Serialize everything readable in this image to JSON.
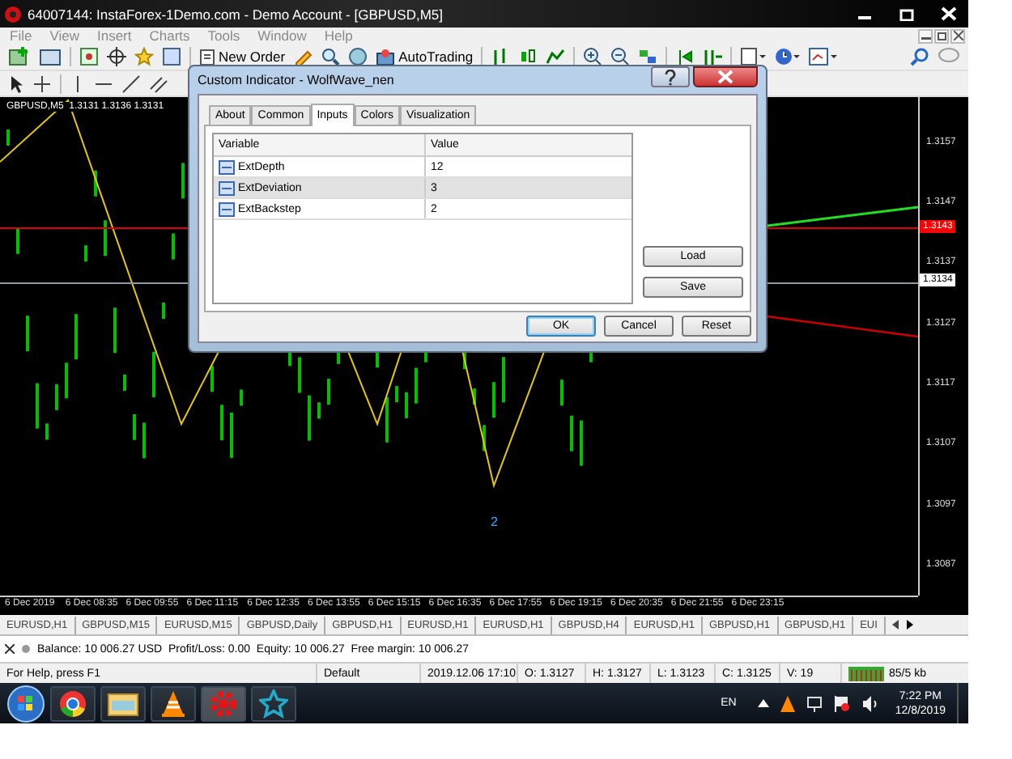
{
  "window": {
    "title": "64007144: InstaForex-1Demo.com - Demo Account - [GBPUSD,M5]"
  },
  "menu": [
    {
      "label": "File",
      "disabled": true
    },
    {
      "label": "View",
      "disabled": true
    },
    {
      "label": "Insert",
      "disabled": true
    },
    {
      "label": "Charts",
      "disabled": true
    },
    {
      "label": "Tools",
      "disabled": true
    },
    {
      "label": "Window",
      "disabled": true
    },
    {
      "label": "Help",
      "disabled": true
    }
  ],
  "toolbar": {
    "buttons": [
      {
        "label": "New Order"
      },
      {
        "label": "AutoTrading"
      }
    ]
  },
  "chart": {
    "header": "GBPUSD,M5  1.3131 1.3136 1.3131",
    "y_labels": [
      "1.3157",
      "1.3147",
      "1.3137",
      "1.3127",
      "1.3117",
      "1.3107",
      "1.3097",
      "1.3087"
    ],
    "price_tags": [
      {
        "text": "1.3143",
        "color": "#ff0000"
      },
      {
        "text": "1.3134",
        "color": "#ffffff"
      }
    ],
    "x_labels": [
      "6 Dec 2019",
      "6 Dec 08:35",
      "6 Dec 09:55",
      "6 Dec 11:15",
      "6 Dec 12:35",
      "6 Dec 13:55",
      "6 Dec 15:15",
      "6 Dec 16:35",
      "6 Dec 17:55",
      "6 Dec 19:15",
      "6 Dec 20:35",
      "6 Dec 21:55",
      "6 Dec 23:15"
    ],
    "wave_label": "2"
  },
  "symbol_tabs": [
    "EURUSD,H1",
    "GBPUSD,M15",
    "EURUSD,M15",
    "GBPUSD,Daily",
    "GBPUSD,H1",
    "EURUSD,H1",
    "EURUSD,H1",
    "GBPUSD,H4",
    "EURUSD,H1",
    "GBPUSD,H1",
    "GBPUSD,H1",
    "EUI"
  ],
  "account": "Balance: 10 006.27 USD  Profit/Loss: 0.00  Equity: 10 006.27  Free margin: 10 006.27",
  "status_bar": [
    "For Help, press F1",
    "Default",
    "2019.12.06 17:10",
    "O: 1.3127",
    "H: 1.3127",
    "L: 1.3123",
    "C: 1.3125",
    "V: 19",
    "85/5 kb"
  ],
  "dialog": {
    "title": "Custom Indicator - WolfWave_nen",
    "tabs": [
      {
        "label": "About",
        "selected": false
      },
      {
        "label": "Common",
        "selected": false
      },
      {
        "label": "Inputs",
        "selected": true
      },
      {
        "label": "Colors",
        "selected": false
      },
      {
        "label": "Visualization",
        "selected": false
      }
    ],
    "columns": [
      "Variable",
      "Value"
    ],
    "rows": [
      {
        "variable": "ExtDepth",
        "value": "12",
        "selected": false
      },
      {
        "variable": "ExtDeviation",
        "value": "3",
        "selected": true
      },
      {
        "variable": "ExtBackstep",
        "value": "2",
        "selected": false
      }
    ],
    "side_buttons": [
      "Load",
      "Save"
    ],
    "buttons": [
      {
        "label": "OK",
        "default": true
      },
      {
        "label": "Cancel",
        "default": false
      },
      {
        "label": "Reset",
        "default": false
      }
    ]
  },
  "taskbar": {
    "language": "EN",
    "time": "7:22 PM",
    "date": "12/8/2019"
  }
}
